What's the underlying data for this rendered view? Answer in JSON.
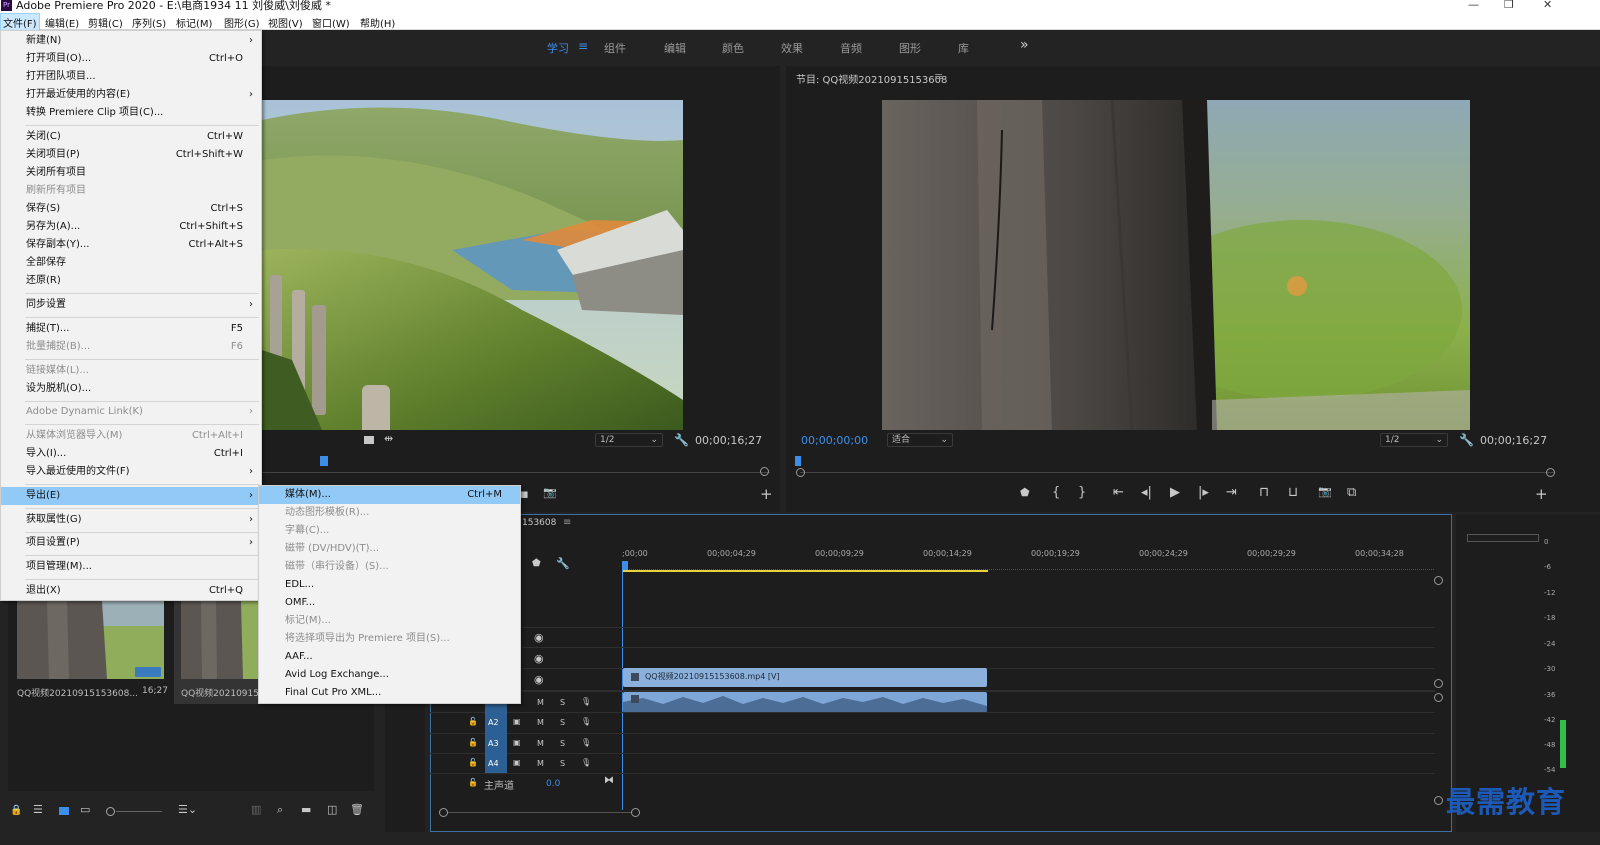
{
  "title_bar": {
    "title": "Adobe Premiere Pro 2020 - E:\\电商1934 11 刘俊威\\刘俊威 *",
    "app_icon": "Pr"
  },
  "menubar": [
    {
      "label": "文件(F)"
    },
    {
      "label": "编辑(E)"
    },
    {
      "label": "剪辑(C)"
    },
    {
      "label": "序列(S)"
    },
    {
      "label": "标记(M)"
    },
    {
      "label": "图形(G)"
    },
    {
      "label": "视图(V)"
    },
    {
      "label": "窗口(W)"
    },
    {
      "label": "帮助(H)"
    }
  ],
  "workspaces": [
    {
      "label": "学习"
    },
    {
      "label": "组件"
    },
    {
      "label": "编辑"
    },
    {
      "label": "颜色"
    },
    {
      "label": "效果"
    },
    {
      "label": "音频"
    },
    {
      "label": "图形"
    },
    {
      "label": "库"
    }
  ],
  "workspace_more": "»",
  "source_monitor": {
    "timecode": "00;00;16;27",
    "scale": "1/2"
  },
  "program_monitor": {
    "title": "节目: QQ视频20210915153608",
    "current_timecode": "00;00;00;00",
    "fit": "适合",
    "scale": "1/2",
    "duration": "00;00;16;27"
  },
  "file_menu": [
    {
      "label": "新建(N)",
      "shortcut": "",
      "submenu": true
    },
    {
      "label": "打开项目(O)...",
      "shortcut": "Ctrl+O"
    },
    {
      "label": "打开团队项目..."
    },
    {
      "label": "打开最近使用的内容(E)",
      "submenu": true
    },
    {
      "label": "转换 Premiere Clip 项目(C)..."
    },
    {
      "label": "关闭(C)",
      "shortcut": "Ctrl+W"
    },
    {
      "label": "关闭项目(P)",
      "shortcut": "Ctrl+Shift+W"
    },
    {
      "label": "关闭所有项目"
    },
    {
      "label": "刷新所有项目",
      "disabled": true
    },
    {
      "label": "保存(S)",
      "shortcut": "Ctrl+S"
    },
    {
      "label": "另存为(A)...",
      "shortcut": "Ctrl+Shift+S"
    },
    {
      "label": "保存副本(Y)...",
      "shortcut": "Ctrl+Alt+S"
    },
    {
      "label": "全部保存"
    },
    {
      "label": "还原(R)"
    },
    {
      "label": "同步设置",
      "submenu": true
    },
    {
      "label": "捕捉(T)...",
      "shortcut": "F5"
    },
    {
      "label": "批量捕捉(B)...",
      "shortcut": "F6",
      "disabled": true
    },
    {
      "label": "链接媒体(L)...",
      "disabled": true
    },
    {
      "label": "设为脱机(O)..."
    },
    {
      "label": "Adobe Dynamic Link(K)",
      "submenu": true,
      "disabled": true
    },
    {
      "label": "从媒体浏览器导入(M)",
      "shortcut": "Ctrl+Alt+I",
      "disabled": true
    },
    {
      "label": "导入(I)...",
      "shortcut": "Ctrl+I"
    },
    {
      "label": "导入最近使用的文件(F)",
      "submenu": true
    },
    {
      "label": "导出(E)",
      "submenu": true,
      "highlighted": true
    },
    {
      "label": "获取属性(G)",
      "submenu": true
    },
    {
      "label": "项目设置(P)",
      "submenu": true
    },
    {
      "label": "项目管理(M)..."
    },
    {
      "label": "退出(X)",
      "shortcut": "Ctrl+Q"
    }
  ],
  "export_submenu": [
    {
      "label": "媒体(M)...",
      "shortcut": "Ctrl+M",
      "highlighted": true
    },
    {
      "label": "动态图形模板(R)...",
      "disabled": true
    },
    {
      "label": "字幕(C)...",
      "disabled": true
    },
    {
      "label": "磁带 (DV/HDV)(T)...",
      "disabled": true
    },
    {
      "label": "磁带（串行设备）(S)...",
      "disabled": true
    },
    {
      "label": "EDL..."
    },
    {
      "label": "OMF..."
    },
    {
      "label": "标记(M)...",
      "disabled": true
    },
    {
      "label": "将选择项导出为 Premiere 项目(S)...",
      "disabled": true
    },
    {
      "label": "AAF..."
    },
    {
      "label": "Avid Log Exchange..."
    },
    {
      "label": "Final Cut Pro XML..."
    }
  ],
  "project_panel": {
    "items": [
      {
        "name": "QQ视频20210915153608...",
        "duration": "16;27"
      },
      {
        "name": "QQ视频20210915"
      }
    ]
  },
  "timeline": {
    "sequence_tab": "153608",
    "ruler_ticks": [
      ";00;00",
      "00;00;04;29",
      "00;00;09;29",
      "00;00;14;29",
      "00;00;19;29",
      "00;00;24;29",
      "00;00;29;29",
      "00;00;34;28"
    ],
    "video_clip": "QQ视频20210915153608.mp4 [V]",
    "audio_tracks": [
      {
        "name": "A2",
        "m": "M",
        "s": "S"
      },
      {
        "name": "A3",
        "m": "M",
        "s": "S"
      },
      {
        "name": "A4",
        "m": "M",
        "s": "S"
      }
    ],
    "master": {
      "label": "主声道",
      "value": "0.0"
    },
    "a1": {
      "m": "M",
      "s": "S"
    }
  },
  "audio_meter": {
    "scale": [
      "0",
      "-6",
      "-12",
      "-18",
      "-24",
      "-30",
      "-36",
      "-42",
      "-48",
      "-54"
    ]
  },
  "watermark": "最需教育",
  "colors": {
    "accent_blue": "#3d8ee8",
    "menu_highlight": "#91c9f7",
    "clip_video": "#8bb0dc"
  }
}
